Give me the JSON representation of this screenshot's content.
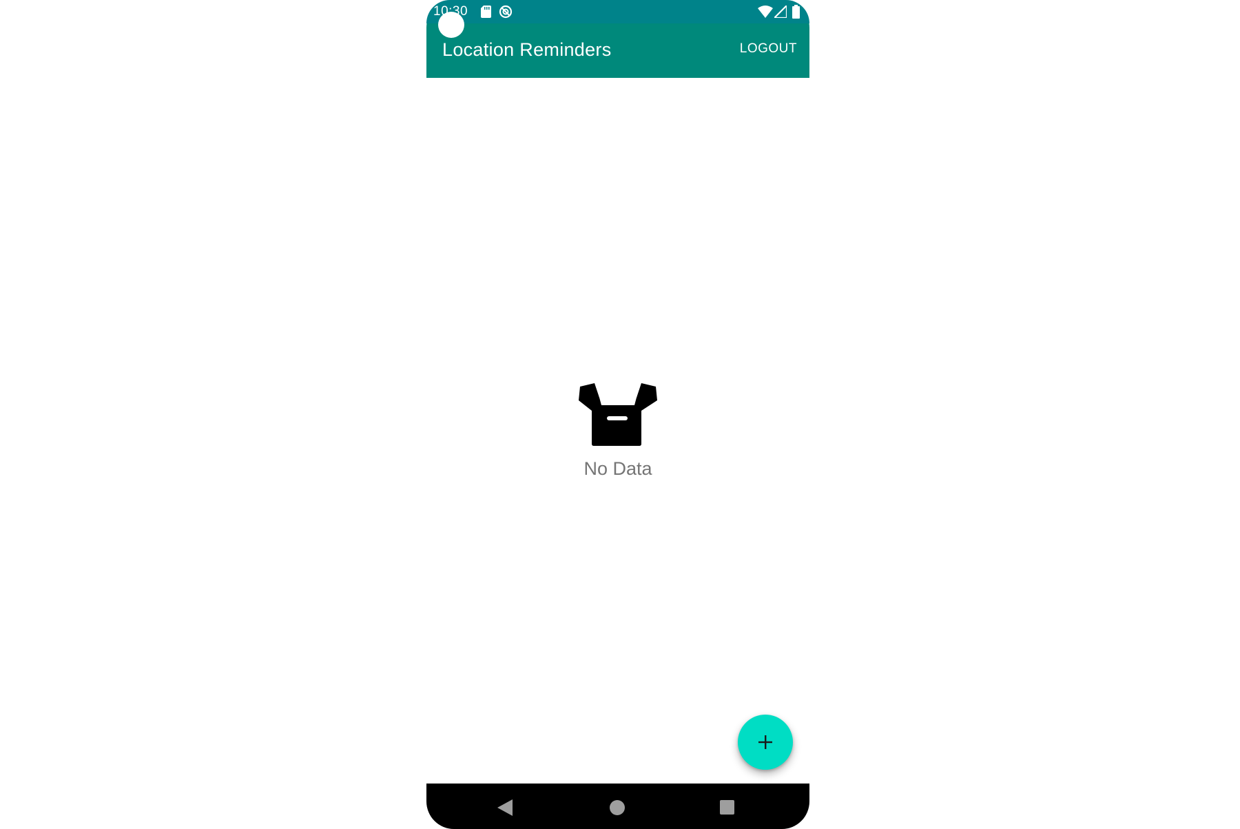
{
  "status_bar": {
    "time": "10:30",
    "icons": [
      "sd-card-icon",
      "sync-icon",
      "wifi-icon",
      "cell-signal-icon",
      "battery-icon"
    ]
  },
  "app_bar": {
    "title": "Location Reminders",
    "logout_label": "LOGOUT",
    "color": "#00897B"
  },
  "empty_state": {
    "icon": "archive-box-icon",
    "text": "No Data"
  },
  "fab": {
    "icon": "plus-icon",
    "color": "#00DDC4"
  },
  "nav_bar": {
    "buttons": [
      "back-icon",
      "home-icon",
      "recents-icon"
    ]
  }
}
